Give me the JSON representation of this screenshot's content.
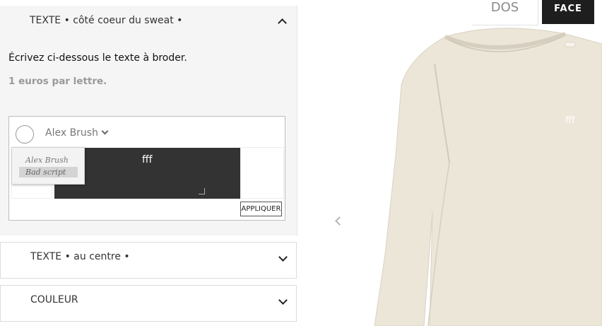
{
  "panel": {
    "section_1": {
      "title": "TEXTE • côté coeur du sweat •",
      "instructions": "Écrivez ci-dessous le texte à broder.",
      "price": "1 euros par lettre.",
      "font_select_value": "Alex Brush",
      "font_options": [
        "Alex Brush",
        "Bad script"
      ],
      "text_value": "fff",
      "apply_label": "APPLIQUER"
    },
    "section_2": {
      "title": "TEXTE • au centre •"
    },
    "section_3": {
      "title": "COULEUR"
    }
  },
  "preview": {
    "tabs": [
      "DOS",
      "FACE"
    ],
    "active_tab": "FACE",
    "embroidery_text": "fff",
    "garment_color": "#ece6d9"
  },
  "colors": {
    "accent_dark": "#333333",
    "panel_bg": "#f5f5f5"
  },
  "icons": [
    "chevron-up-icon",
    "chevron-down-icon",
    "chevron-left-icon"
  ]
}
